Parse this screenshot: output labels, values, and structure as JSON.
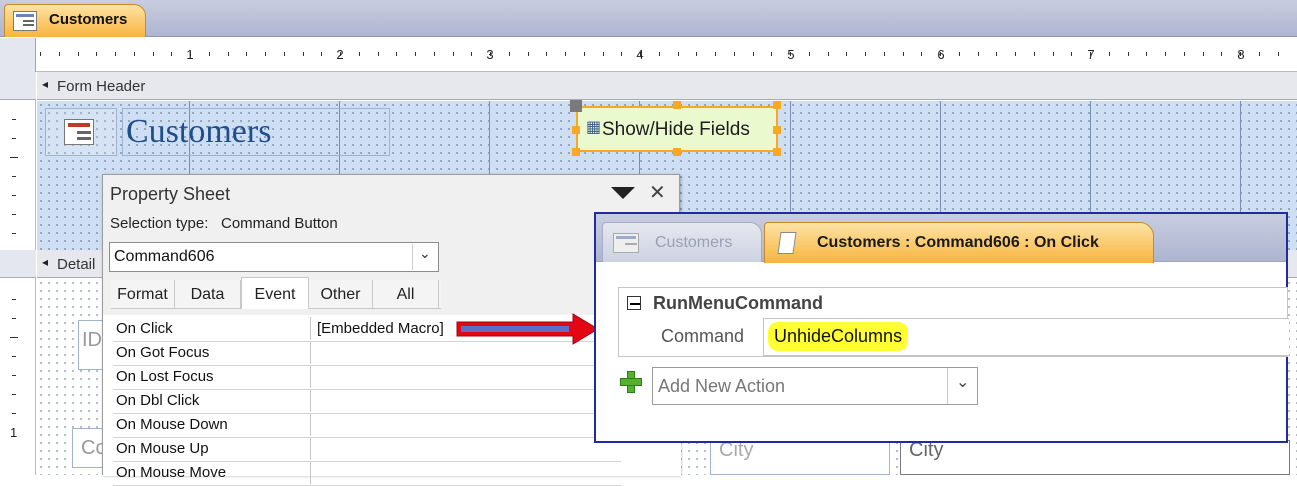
{
  "document_tab": {
    "title": "Customers",
    "icon": "form-icon"
  },
  "ruler": {
    "numbers": [
      "1",
      "2",
      "3",
      "4",
      "5",
      "6",
      "7",
      "8"
    ],
    "vertical_number": "1"
  },
  "sections": {
    "form_header": "Form Header",
    "detail": "Detail"
  },
  "form_header": {
    "title": "Customers",
    "button_label": "Show/Hide Fields"
  },
  "background_controls": {
    "id_label": "ID",
    "co_label": "Co",
    "city_label": "City",
    "city_field": "City"
  },
  "property_sheet": {
    "title": "Property Sheet",
    "selection_type_label": "Selection type:",
    "selection_type_value": "Command Button",
    "selected_object": "Command606",
    "tabs": [
      {
        "label": "Format",
        "active": false
      },
      {
        "label": "Data",
        "active": false
      },
      {
        "label": "Event",
        "active": true
      },
      {
        "label": "Other",
        "active": false
      },
      {
        "label": "All",
        "active": false
      }
    ],
    "rows": [
      {
        "label": "On Click",
        "value": "[Embedded Macro]"
      },
      {
        "label": "On Got Focus",
        "value": ""
      },
      {
        "label": "On Lost Focus",
        "value": ""
      },
      {
        "label": "On Dbl Click",
        "value": ""
      },
      {
        "label": "On Mouse Down",
        "value": ""
      },
      {
        "label": "On Mouse Up",
        "value": ""
      },
      {
        "label": "On Mouse Move",
        "value": ""
      }
    ]
  },
  "macro_window": {
    "inactive_tab": "Customers",
    "active_tab": "Customers : Command606 : On Click",
    "action_name": "RunMenuCommand",
    "argument_label": "Command",
    "argument_value": "UnhideColumns",
    "add_action_placeholder": "Add New Action"
  },
  "colors": {
    "accent_orange": "#f9a825",
    "highlight_yellow": "#ffff33",
    "arrow_red": "#e30613",
    "frame_blue": "#1f2b9e"
  }
}
